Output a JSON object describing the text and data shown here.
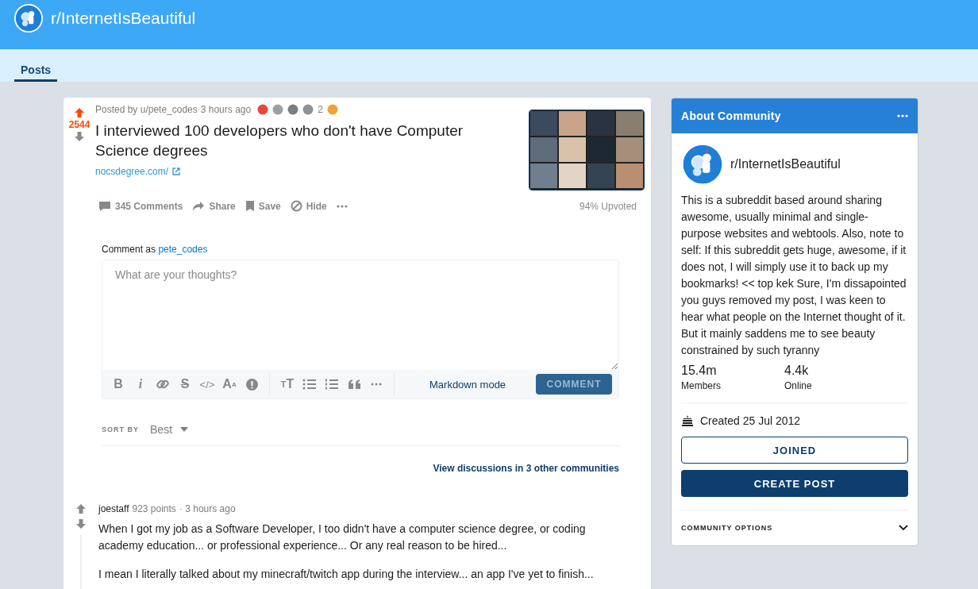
{
  "header": {
    "community": "r/InternetIsBeautiful"
  },
  "tabs": [
    {
      "label": "Posts",
      "selected": true
    }
  ],
  "post": {
    "upvoted": true,
    "score": "2544",
    "posted_by": "Posted by u/pete_codes",
    "time": "3 hours ago",
    "awards": [
      {
        "color": "#e8483a"
      },
      {
        "color": "#9aa0a6"
      },
      {
        "color": "#7a7f85"
      },
      {
        "color": "#8d9297",
        "count": "2"
      },
      {
        "color": "#f0a33a"
      }
    ],
    "title": "I interviewed 100 developers who don't have Computer Science degrees",
    "link": "nocsdegree.com/",
    "actions": [
      {
        "kind": "comments",
        "label": "345 Comments"
      },
      {
        "kind": "share",
        "label": "Share"
      },
      {
        "kind": "save",
        "label": "Save"
      },
      {
        "kind": "hide",
        "label": "Hide"
      },
      {
        "kind": "more"
      }
    ],
    "upvoted_ratio": "94% Upvoted"
  },
  "composer": {
    "comment_as": "Comment as",
    "user": "pete_codes",
    "placeholder": "What are your thoughts?",
    "format_tools": [
      {
        "kind": "bold",
        "label": "B"
      },
      {
        "kind": "italic",
        "label": "i"
      },
      {
        "kind": "link"
      },
      {
        "kind": "strike",
        "label": "S"
      },
      {
        "kind": "code",
        "label": "</>"
      },
      {
        "kind": "superscript",
        "label": "A",
        "sup": "A"
      },
      {
        "kind": "spoiler"
      }
    ],
    "block_tools": [
      {
        "kind": "heading",
        "small": "T",
        "label": "T"
      },
      {
        "kind": "bullets"
      },
      {
        "kind": "numbers"
      },
      {
        "kind": "quote"
      },
      {
        "kind": "more"
      }
    ],
    "markdown_mode": "Markdown mode",
    "submit": "COMMENT"
  },
  "sort": {
    "label": "SORT BY",
    "value": "Best"
  },
  "other_discussions": "View discussions in 3 other communities",
  "comments": [
    {
      "author": "joestaff",
      "points": "923 points",
      "time": "· 3 hours ago",
      "paragraphs": [
        "When I got my job as a Software Developer, I too didn't have a computer science degree, or coding academy education... or professional experience... Or any real reason to be hired...",
        "I mean I literally talked about my minecraft/twitch app during the interview... an app I've yet to finish..."
      ]
    }
  ],
  "sidebar": {
    "title": "About Community",
    "name": "r/InternetIsBeautiful",
    "description": "This is a subreddit based around sharing awesome, usually minimal and single-purpose websites and webtools. Also, note to self: If this subreddit gets huge, awesome, if it does not, I will simply use it to back up my bookmarks! << top kek Sure, I'm dissapointed you guys removed my post, I was keen to hear what people on the Internet thought of it. But it mainly saddens me to see beauty constrained by such tyranny",
    "stats": [
      {
        "value": "15.4m",
        "label": "Members"
      },
      {
        "value": "4.4k",
        "label": "Online"
      }
    ],
    "created": "Created 25 Jul 2012",
    "joined_button": "JOINED",
    "create_button": "CREATE POST",
    "options": "COMMUNITY OPTIONS"
  }
}
